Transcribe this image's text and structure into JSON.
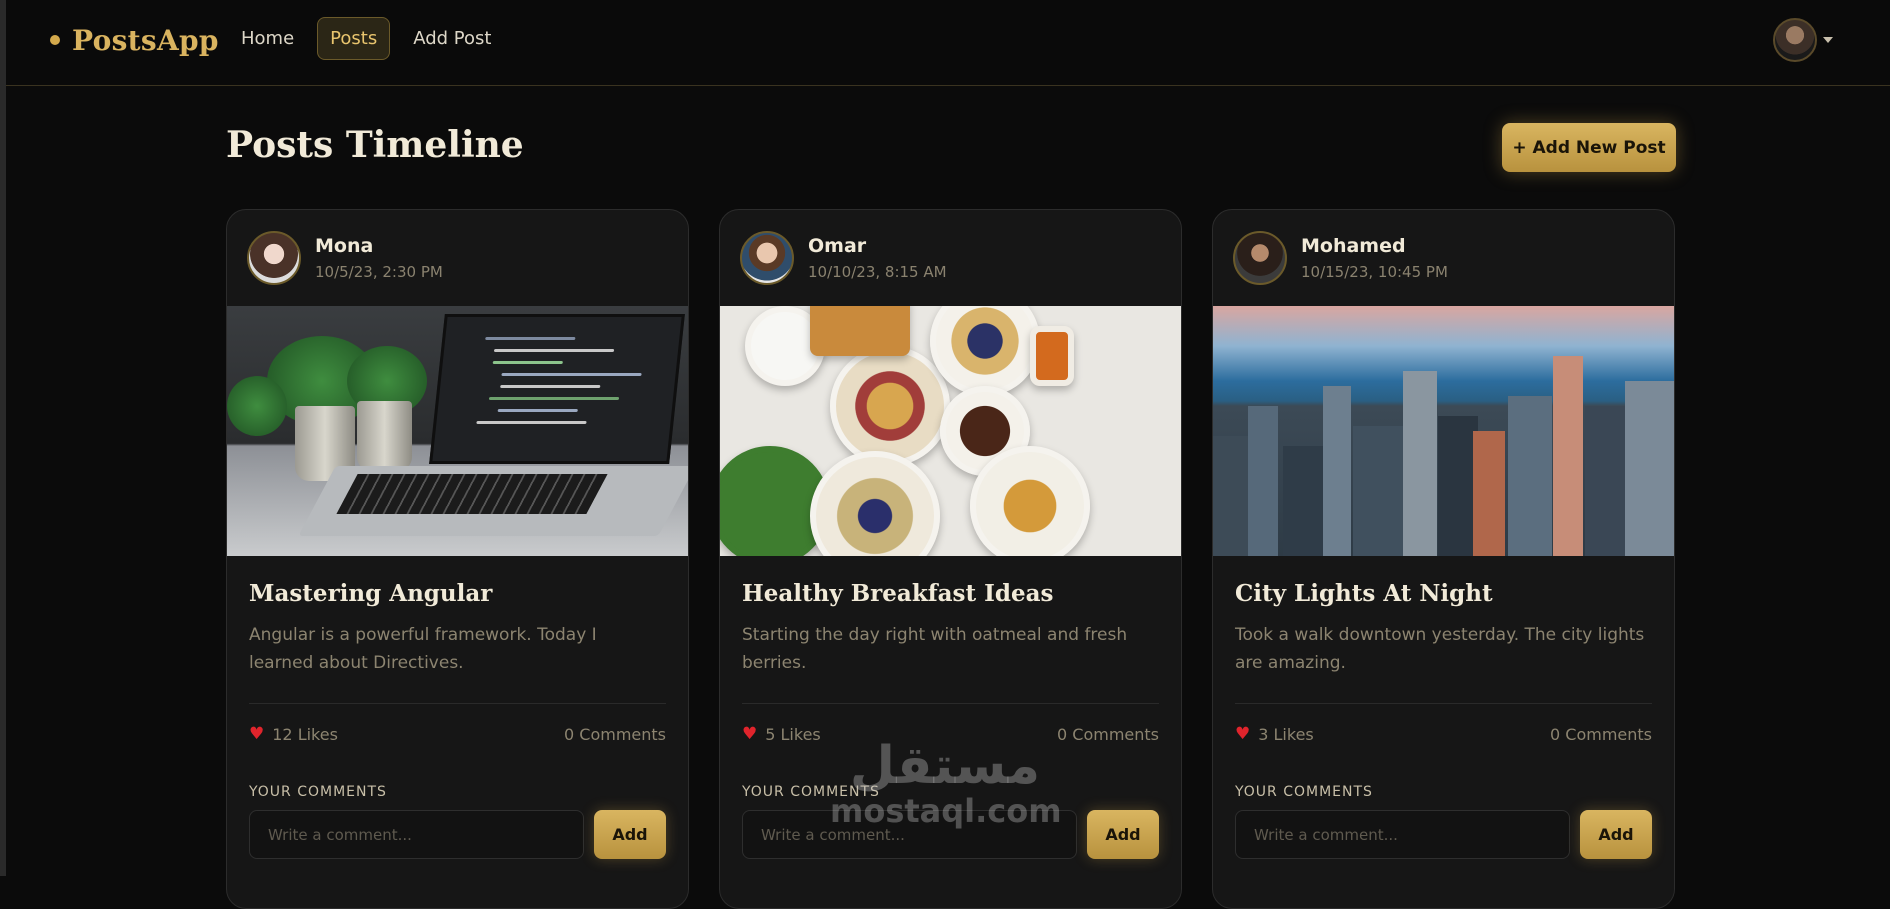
{
  "navbar": {
    "brand": "PostsApp",
    "links": [
      {
        "label": "Home",
        "active": false
      },
      {
        "label": "Posts",
        "active": true
      },
      {
        "label": "Add Post",
        "active": false
      }
    ]
  },
  "main": {
    "title": "Posts Timeline",
    "add_new_post_label": "+ Add New Post"
  },
  "posts": [
    {
      "author": "Mona",
      "time": "10/5/23, 2:30 PM",
      "image": "laptop-with-code-and-plants",
      "title": "Mastering Angular",
      "text": "Angular is a powerful framework. Today I learned about Directives.",
      "likes": "12 Likes",
      "comments": "0 Comments",
      "comments_label": "YOUR COMMENTS",
      "comment_placeholder": "Write a comment...",
      "add_label": "Add"
    },
    {
      "author": "Omar",
      "time": "10/10/23, 8:15 AM",
      "image": "breakfast-bowls-and-waffles",
      "title": "Healthy Breakfast Ideas",
      "text": "Starting the day right with oatmeal and fresh berries.",
      "likes": "5 Likes",
      "comments": "0 Comments",
      "comments_label": "YOUR COMMENTS",
      "comment_placeholder": "Write a comment...",
      "add_label": "Add"
    },
    {
      "author": "Mohamed",
      "time": "10/15/23, 10:45 PM",
      "image": "city-skyline-by-lake",
      "title": "City Lights At Night",
      "text": "Took a walk downtown yesterday. The city lights are amazing.",
      "likes": "3 Likes",
      "comments": "0 Comments",
      "comments_label": "YOUR COMMENTS",
      "comment_placeholder": "Write a comment...",
      "add_label": "Add"
    }
  ],
  "watermark": {
    "arabic": "مستقل",
    "latin": "mostaql.com"
  },
  "colors": {
    "background": "#0b0b0b",
    "card": "#161616",
    "accent_gold": "#d4a94c",
    "heart": "#e0242c"
  },
  "icons": {
    "like": "heart-icon",
    "profile_menu": "chevron-down-icon"
  }
}
